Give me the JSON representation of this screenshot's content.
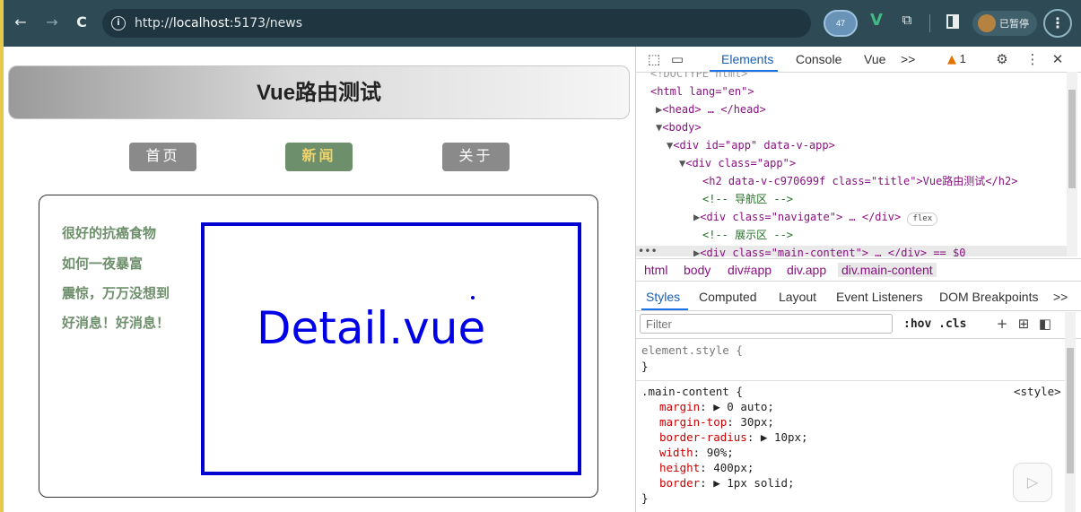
{
  "browser": {
    "back_icon": "←",
    "forward_icon": "→",
    "reload_icon": "C",
    "url_prefix": "http://",
    "url_host": "localhost",
    "url_rest": ":5173/news",
    "ext_badge": "47",
    "vue_ext": "V",
    "profile_name": "已暂停",
    "menu_glyph": "⋮"
  },
  "app": {
    "title": "Vue路由测试",
    "nav": [
      {
        "label": "首页",
        "active": false
      },
      {
        "label": "新闻",
        "active": true
      },
      {
        "label": "关于",
        "active": false
      }
    ],
    "news_list": [
      "很好的抗癌食物",
      "如何一夜暴富",
      "震惊，万万没想到",
      "好消息！好消息！"
    ],
    "detail_text": "Detail.vue"
  },
  "devtools": {
    "tabs": [
      "Elements",
      "Console",
      "Vue",
      ">>"
    ],
    "active_tab": "Elements",
    "warning_count": "1",
    "dom_lines": [
      {
        "t": "<!DOCTYPE html>",
        "indent": 0
      },
      {
        "t": "<html lang=\"en\">",
        "indent": 0
      },
      {
        "t": "<head> … </head>",
        "indent": 1
      },
      {
        "t": "<body>",
        "indent": 1
      },
      {
        "t": "<div id=\"app\" data-v-app>",
        "indent": 2
      },
      {
        "t": "<div class=\"app\">",
        "indent": 3
      },
      {
        "t": "<h2 data-v-c970699f class=\"title\">Vue路由测试</h2>",
        "indent": 4
      },
      {
        "t": "<!-- 导航区 -->",
        "indent": 4
      },
      {
        "t": "<div class=\"navigate\"> … </div>",
        "indent": 4
      },
      {
        "t": "<!-- 展示区 -->",
        "indent": 4
      },
      {
        "t": "<div class=\"main-content\"> … </div> == $0",
        "indent": 4
      }
    ],
    "flex_badge": "flex",
    "breadcrumbs": [
      "html",
      "body",
      "div#app",
      "div.app",
      "div.main-content"
    ],
    "styles_tabs": [
      "Styles",
      "Computed",
      "Layout",
      "Event Listeners",
      "DOM Breakpoints",
      ">>"
    ],
    "filter_placeholder": "Filter",
    "filter_tools": ":hov  .cls",
    "element_style": "element.style {",
    "close_brace": "}",
    "rule_selector": ".main-content {",
    "rule_source": "<style>",
    "rule_props": [
      {
        "name": "margin",
        "value": "▶ 0 auto;"
      },
      {
        "name": "margin-top",
        "value": "30px;"
      },
      {
        "name": "border-radius",
        "value": "▶ 10px;"
      },
      {
        "name": "width",
        "value": "90%;"
      },
      {
        "name": "height",
        "value": "400px;"
      },
      {
        "name": "border",
        "value": "▶ 1px solid;"
      }
    ]
  }
}
